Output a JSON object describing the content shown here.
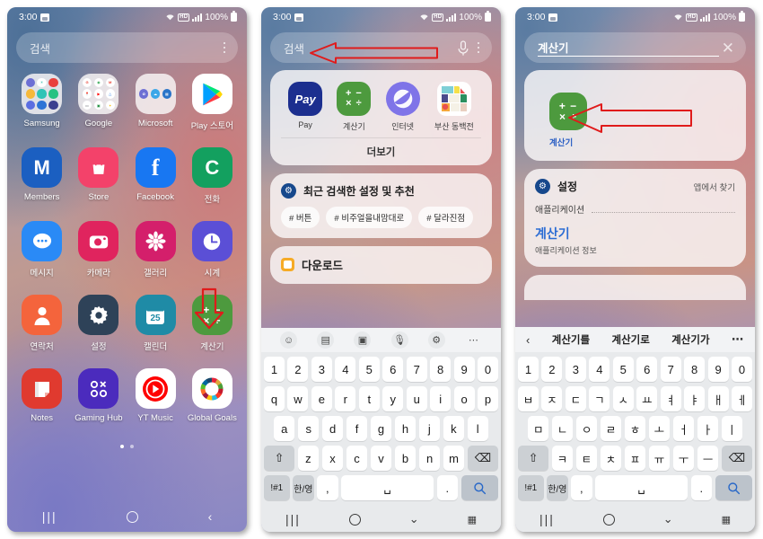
{
  "statusbar": {
    "time": "3:00",
    "network_label": "HD",
    "battery_text": "100%",
    "icons": [
      "image-icon",
      "wifi-icon",
      "hd-icon",
      "signal-icon",
      "battery-icon"
    ]
  },
  "panel1": {
    "search": {
      "placeholder": "검색",
      "menu_icon": "kebab-menu-icon"
    },
    "apps": [
      {
        "label": "Samsung",
        "type": "folder",
        "colors": [
          "#6d6fd4",
          "#3bc9db",
          "#e8413c",
          "#f6b93b",
          "#2ec4b6",
          "#26c281",
          "#5b6ee1",
          "#2d74d6",
          "#3b3f8f"
        ]
      },
      {
        "label": "Google",
        "type": "folder",
        "colors": [
          "#ffffff",
          "#ffffff",
          "#ffffff",
          "#ffffff",
          "#ffffff",
          "#ffffff",
          "#ffffff",
          "#ffffff",
          "#ffffff"
        ]
      },
      {
        "label": "Microsoft",
        "type": "folder",
        "colors": [
          "#6d6fd4",
          "#3ba7e8",
          "#2a74c8"
        ]
      },
      {
        "label": "Play 스토어",
        "type": "play"
      },
      {
        "label": "Members",
        "type": "glyph",
        "glyph": "M",
        "class": "ic-members"
      },
      {
        "label": "Store",
        "type": "glyph",
        "glyph": "bag",
        "class": "ic-store"
      },
      {
        "label": "Facebook",
        "type": "glyph",
        "glyph": "f",
        "class": "ic-fb"
      },
      {
        "label": "전화",
        "type": "glyph",
        "glyph": "C",
        "class": "ic-phone"
      },
      {
        "label": "메시지",
        "type": "glyph",
        "glyph": "chat",
        "class": "ic-msg"
      },
      {
        "label": "카메라",
        "type": "glyph",
        "glyph": "cam",
        "class": "ic-cam"
      },
      {
        "label": "갤러리",
        "type": "glyph",
        "glyph": "flower",
        "class": "ic-gal"
      },
      {
        "label": "시계",
        "type": "glyph",
        "glyph": "clock",
        "class": "ic-clock"
      },
      {
        "label": "연락처",
        "type": "glyph",
        "glyph": "person",
        "class": "ic-contacts"
      },
      {
        "label": "설정",
        "type": "glyph",
        "glyph": "gear",
        "class": "ic-settings"
      },
      {
        "label": "캘린더",
        "type": "glyph",
        "glyph": "25",
        "class": "ic-cal"
      },
      {
        "label": "계산기",
        "type": "calc",
        "class": "ic-calc"
      },
      {
        "label": "Notes",
        "type": "glyph",
        "glyph": "note",
        "class": "ic-notes"
      },
      {
        "label": "Gaming Hub",
        "type": "glyph",
        "glyph": "oxoo",
        "class": "ic-gaming"
      },
      {
        "label": "YT Music",
        "type": "ytm"
      },
      {
        "label": "Global Goals",
        "type": "gg"
      }
    ],
    "page_dots": {
      "count": 2,
      "active": 0
    },
    "nav": {
      "recents": "recents-button",
      "home": "home-button",
      "back": "back-button"
    }
  },
  "panel2": {
    "search": {
      "placeholder": "검색",
      "mic_icon": "microphone-icon",
      "menu_icon": "kebab-menu-icon"
    },
    "suggested_apps": [
      {
        "label": "Pay",
        "icon": "samsung-pay-icon"
      },
      {
        "label": "계산기",
        "icon": "calculator-icon"
      },
      {
        "label": "인터넷",
        "icon": "samsung-internet-icon"
      },
      {
        "label": "부산 동백전",
        "icon": "busan-dongbaekjeon-icon"
      }
    ],
    "more_label": "더보기",
    "recent_card": {
      "title": "최근 검색한 설정 및 추천",
      "icon": "settings-gear-icon",
      "chips": [
        "# 버튼",
        "# 비주얼을내맘대로",
        "# 달라진점"
      ]
    },
    "download_card": {
      "title": "다운로드",
      "icon": "folder-icon"
    },
    "keyboard": {
      "toolbar_icons": [
        "emoji-icon",
        "clipboard-icon",
        "text-edit-icon",
        "microphone-icon",
        "settings-gear-icon",
        "more-options-icon"
      ],
      "rows": [
        [
          "1",
          "2",
          "3",
          "4",
          "5",
          "6",
          "7",
          "8",
          "9",
          "0"
        ],
        [
          "q",
          "w",
          "e",
          "r",
          "t",
          "y",
          "u",
          "i",
          "o",
          "p"
        ],
        [
          "a",
          "s",
          "d",
          "f",
          "g",
          "h",
          "j",
          "k",
          "l"
        ],
        [
          "z",
          "x",
          "c",
          "v",
          "b",
          "n",
          "m"
        ]
      ],
      "shift_key": "⇧",
      "backspace_key": "⌫",
      "symbol_key": "!#1",
      "lang_key": "한/영",
      "comma_key": ",",
      "space_key": "",
      "period_key": ".",
      "search_key": "search-icon"
    },
    "nav": {
      "recents": "recents-button",
      "home": "home-button",
      "hide_kb": "hide-keyboard-button",
      "kb_switch": "keyboard-switch-button"
    },
    "annotation": {
      "type": "left-arrow",
      "color": "#e01b1b"
    }
  },
  "panel3": {
    "search": {
      "value": "계산기",
      "clear_icon": "close-icon"
    },
    "app_result": {
      "label": "계산기",
      "icon": "calculator-icon"
    },
    "settings_card": {
      "title": "설정",
      "icon": "settings-gear-icon",
      "right_label": "앱에서 찾기",
      "section_label": "애플리케이션",
      "result_title": "계산기",
      "result_sub": "애플리케이션 정보"
    },
    "keyboard": {
      "suggestions": [
        "계산기를",
        "계산기로",
        "계산기가"
      ],
      "back_icon": "chevron-left-icon",
      "more_icon": "more-options-icon",
      "rows": [
        [
          "1",
          "2",
          "3",
          "4",
          "5",
          "6",
          "7",
          "8",
          "9",
          "0"
        ],
        [
          "ㅂ",
          "ㅈ",
          "ㄷ",
          "ㄱ",
          "ㅅ",
          "ㅛ",
          "ㅕ",
          "ㅑ",
          "ㅐ",
          "ㅔ"
        ],
        [
          "ㅁ",
          "ㄴ",
          "ㅇ",
          "ㄹ",
          "ㅎ",
          "ㅗ",
          "ㅓ",
          "ㅏ",
          "ㅣ"
        ],
        [
          "ㅋ",
          "ㅌ",
          "ㅊ",
          "ㅍ",
          "ㅠ",
          "ㅜ",
          "ㅡ"
        ]
      ],
      "shift_key": "⇧",
      "backspace_key": "⌫",
      "symbol_key": "!#1",
      "lang_key": "한/영",
      "comma_key": ",",
      "period_key": ".",
      "search_key": "search-icon"
    },
    "nav": {
      "recents": "recents-button",
      "home": "home-button",
      "hide_kb": "hide-keyboard-button",
      "kb_switch": "keyboard-switch-button"
    },
    "annotation": {
      "type": "left-arrow",
      "color": "#e01b1b"
    }
  },
  "colors": {
    "annotation_red": "#e01b1b",
    "calculator_green": "#4d9a3e",
    "link_blue": "#2b6cd4"
  }
}
